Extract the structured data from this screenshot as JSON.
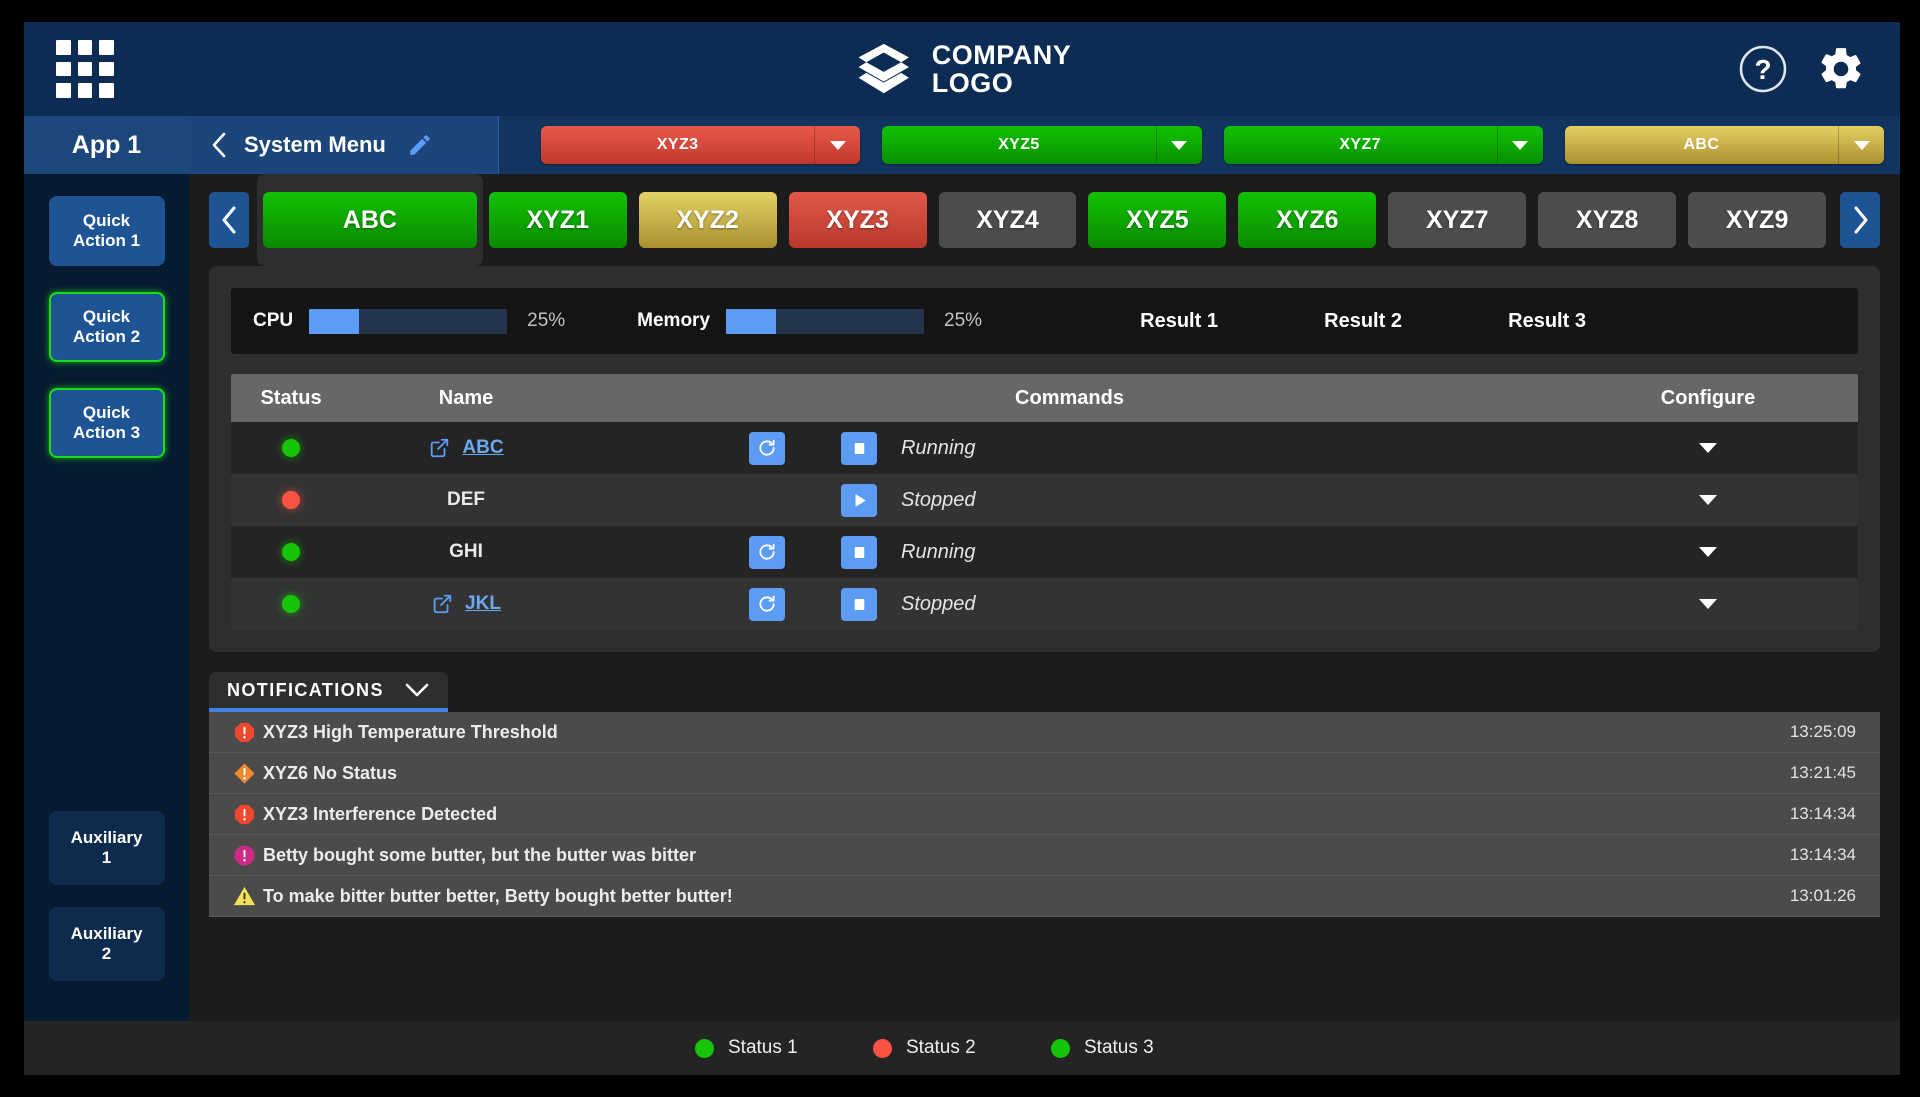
{
  "topbar": {
    "apps_icon": "grid-apps-icon",
    "logo_line1": "COMPANY",
    "logo_line2": "LOGO",
    "help_icon": "help-circle-icon",
    "settings_icon": "gear-icon"
  },
  "menubar": {
    "app_label": "App 1",
    "system_menu": "System Menu",
    "back_icon": "chevron-left-icon",
    "edit_icon": "pencil-icon",
    "buttons": [
      {
        "label": "XYZ3",
        "color": "#c0392b",
        "style": "red"
      },
      {
        "label": "XYZ5",
        "color": "#079000",
        "style": "green"
      },
      {
        "label": "XYZ7",
        "color": "#079000",
        "style": "green"
      },
      {
        "label": "ABC",
        "color": "#ab9030",
        "style": "gold"
      }
    ]
  },
  "rail": {
    "quick_actions": [
      {
        "label": "Quick\nAction 1",
        "highlighted": false
      },
      {
        "label": "Quick\nAction 2",
        "highlighted": true
      },
      {
        "label": "Quick\nAction 3",
        "highlighted": true
      }
    ],
    "auxiliary": [
      {
        "label": "Auxiliary\n1"
      },
      {
        "label": "Auxiliary\n2"
      }
    ]
  },
  "tabstrip": {
    "prev_icon": "chevron-left-icon",
    "next_icon": "chevron-right-icon",
    "tabs": [
      {
        "label": "ABC",
        "style": "green",
        "selected": true
      },
      {
        "label": "XYZ1",
        "style": "green",
        "selected": false
      },
      {
        "label": "XYZ2",
        "style": "gold",
        "selected": false
      },
      {
        "label": "XYZ3",
        "style": "red",
        "selected": false
      },
      {
        "label": "XYZ4",
        "style": "grey",
        "selected": false
      },
      {
        "label": "XYZ5",
        "style": "green",
        "selected": false
      },
      {
        "label": "XYZ6",
        "style": "green",
        "selected": false
      },
      {
        "label": "XYZ7",
        "style": "grey",
        "selected": false
      },
      {
        "label": "XYZ8",
        "style": "grey",
        "selected": false
      },
      {
        "label": "XYZ9",
        "style": "grey",
        "selected": false
      }
    ]
  },
  "stats": {
    "cpu_label": "CPU",
    "cpu_value": "25%",
    "cpu_percent": 25,
    "memory_label": "Memory",
    "memory_value": "25%",
    "memory_percent": 25,
    "results": [
      "Result 1",
      "Result 2",
      "Result 3"
    ]
  },
  "table": {
    "headers": [
      "Status",
      "Name",
      "Commands",
      "Configure"
    ],
    "rows": [
      {
        "status": "green",
        "name": "ABC",
        "is_link": true,
        "has_external_icon": true,
        "commands": [
          "restart-icon",
          "stop-icon"
        ],
        "state": "Running",
        "configure_icon": "chevron-down-icon"
      },
      {
        "status": "red",
        "name": "DEF",
        "is_link": false,
        "has_external_icon": false,
        "commands": [
          "play-icon"
        ],
        "state": "Stopped",
        "configure_icon": "chevron-down-icon"
      },
      {
        "status": "green",
        "name": "GHI",
        "is_link": false,
        "has_external_icon": false,
        "commands": [
          "restart-icon",
          "stop-icon"
        ],
        "state": "Running",
        "configure_icon": "chevron-down-icon"
      },
      {
        "status": "green",
        "name": "JKL",
        "is_link": true,
        "has_external_icon": true,
        "commands": [
          "restart-icon",
          "stop-icon"
        ],
        "state": "Stopped",
        "configure_icon": "chevron-down-icon"
      }
    ]
  },
  "notifications": {
    "tab_label": "NOTIFICATIONS",
    "collapse_icon": "chevron-down-icon",
    "items": [
      {
        "severity": "critical",
        "icon": "octagon-alert-icon",
        "color": "#f0472e",
        "message": "XYZ3 High Temperature Threshold",
        "time": "13:25:09"
      },
      {
        "severity": "warning",
        "icon": "diamond-alert-icon",
        "color": "#f0892e",
        "message": "XYZ6 No Status",
        "time": "13:21:45"
      },
      {
        "severity": "critical",
        "icon": "octagon-alert-icon",
        "color": "#f0472e",
        "message": "XYZ3 Interference Detected",
        "time": "13:14:34"
      },
      {
        "severity": "info",
        "icon": "circle-alert-icon",
        "color": "#cc2a84",
        "message": "Betty bought some butter, but the butter was bitter",
        "time": "13:14:34"
      },
      {
        "severity": "caution",
        "icon": "triangle-alert-icon",
        "color": "#f3e259",
        "message": "To make bitter butter better, Betty bought better butter!",
        "time": "13:01:26"
      }
    ]
  },
  "footer": {
    "statuses": [
      {
        "label": "Status 1",
        "color": "#16c40a"
      },
      {
        "label": "Status 2",
        "color": "#fa5343"
      },
      {
        "label": "Status 3",
        "color": "#16c40a"
      }
    ]
  }
}
